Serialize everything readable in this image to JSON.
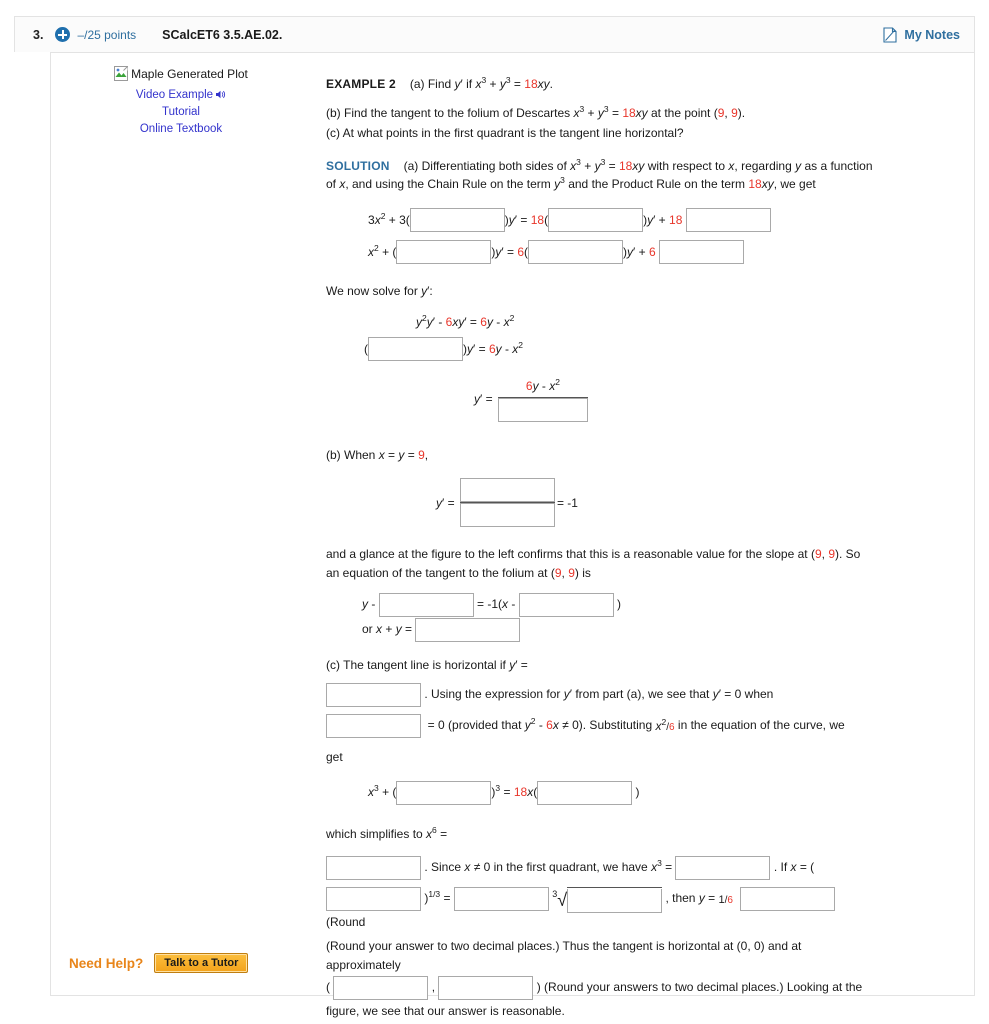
{
  "header": {
    "question_number": "3.",
    "points": "–/25 points",
    "question_key": "SCalcET6 3.5.AE.02.",
    "my_notes_label": "My Notes",
    "plus_icon": "plus-circle-icon",
    "note_icon": "note-page-icon"
  },
  "left_panel": {
    "figure_alt": "Maple Generated Plot",
    "links": [
      {
        "label": "Video Example",
        "icon": "speaker-icon"
      },
      {
        "label": "Tutorial",
        "icon": ""
      },
      {
        "label": "Online Textbook",
        "icon": ""
      }
    ]
  },
  "content": {
    "example_label": "EXAMPLE 2",
    "part_a_prompt_1": "(a) Find ",
    "part_a_prompt_2": "y",
    "part_a_prompt_3": "′ if ",
    "part_a_eq_x3": "x",
    "part_a_plus": " + ",
    "part_a_eq_y3": "y",
    "part_a_equals": " = ",
    "part_a_18": "18",
    "part_a_xy": "xy",
    "part_a_period": ".",
    "part_b_prompt": "(b) Find the tangent to the folium of Descartes ",
    "part_b_at": " at the point (",
    "part_b_pt1": "9",
    "part_b_comma": ", ",
    "part_b_pt2": "9",
    "part_b_close": ").",
    "part_c_prompt": "(c) At what points in the first quadrant is the tangent line horizontal?",
    "solution_label": "SOLUTION",
    "sol_a_1": "(a) Differentiating both sides of ",
    "sol_a_2": " with respect to ",
    "sol_a_3": ", regarding ",
    "sol_a_4": " as a function of ",
    "sol_a_5": ", and using the Chain Rule on the term ",
    "sol_a_6": " and the Product Rule on the term ",
    "sol_a_7": ", we get",
    "eq1": {
      "t1": "3",
      "t1v": "x",
      "t1s": "2",
      "t2": " + 3(",
      "t3": ")",
      "t3v": "y",
      "t3p": "′ = ",
      "t4": "18",
      "t5": "(",
      "t6": ")",
      "t6v": "y",
      "t6p": "′ + ",
      "t7": "18"
    },
    "eq2": {
      "t1v": "x",
      "t1s": "2",
      "t2": " + (",
      "t3": ")",
      "t3v": "y",
      "t3p": "′ = ",
      "t4": "6",
      "t5": "(",
      "t6": ")",
      "t6v": "y",
      "t6p": "′ + ",
      "t7": "6"
    },
    "solve_text_1": "We now solve for ",
    "solve_text_2": "y",
    "solve_text_3": "′:",
    "eq3": {
      "a": "y",
      "a_sup": "2",
      "a2": "y",
      "a3": "′ - ",
      "six": "6",
      "b": "xy",
      "b2": "′ = ",
      "six2": "6",
      "c": "y",
      "c2": " - ",
      "d": "x",
      "d_sup": "2"
    },
    "eq4": {
      "open": "(",
      "close": ")",
      "yp": "y",
      "yp2": "′ = ",
      "six": "6",
      "c": "y",
      "c2": " - ",
      "d": "x",
      "d_sup": "2"
    },
    "eq5": {
      "yp": "y",
      "yp2": "′ = ",
      "num_six": "6",
      "num_y": "y",
      "num_minus": " - ",
      "num_x": "x",
      "num_sup": "2"
    },
    "part_b_when_1": "(b) When ",
    "part_b_when_x": "x",
    "part_b_when_eq": " = ",
    "part_b_when_y": "y",
    "part_b_when_eq2": " = ",
    "part_b_when_9": "9",
    "part_b_when_comma": ",",
    "eq6": {
      "yp": "y",
      "yp2": " = ",
      "result": "= -1"
    },
    "glance_1": "and a glance at the figure to the left confirms that this is a reasonable value for the slope at (",
    "glance_9a": "9",
    "glance_comma": ", ",
    "glance_9b": "9",
    "glance_2": "). So an equation of the tangent to the folium at (",
    "glance_9c": "9",
    "glance_9d": "9",
    "glance_3": ") is",
    "eq7": {
      "y": "y",
      "minus": " - ",
      "eq": " = -1(",
      "x": "x",
      "minus2": " - ",
      "close": ")"
    },
    "eq8": {
      "or": "or ",
      "x": "x",
      "plus": " + ",
      "y": "y",
      "eq": " = "
    },
    "part_c_1": "(c) The tangent line is horizontal if ",
    "part_c_yp": "y",
    "part_c_eq": "′ =",
    "part_c_2": ". Using the expression for ",
    "part_c_yp2": "y",
    "part_c_3": "′ from part (a), we see that ",
    "part_c_yp3": "y",
    "part_c_4": "′ = 0 when",
    "part_c_5": " = 0 (provided that ",
    "part_c_y2": "y",
    "part_c_y2s": "2",
    "part_c_6": " - ",
    "part_c_6x_red": "6",
    "part_c_x": "x",
    "part_c_7": " ≠ 0). Substituting ",
    "part_c_sub_x": "x",
    "part_c_sub_sup": "2",
    "part_c_sub_slash": "/",
    "part_c_sub_6": "6",
    "part_c_8": " in the equation of the curve, we get",
    "eq9": {
      "x": "x",
      "sup": "3",
      "plus": " + (",
      "close": ")",
      "close_sup": "3",
      "eq": " = ",
      "eighteen": "18",
      "xopen": "x(",
      "rclose": ")"
    },
    "simplifies_1": "which simplifies to ",
    "simplifies_x": "x",
    "simplifies_sup": "6",
    "simplifies_eq": " =",
    "since_1": ". Since ",
    "since_x": "x",
    "since_2": " ≠ 0 in the first quadrant, we have ",
    "since_x3": "x",
    "since_x3_sup": "3",
    "since_eq": " = ",
    "since_3": ". If ",
    "since_x2": "x",
    "since_4": " = (",
    "cube_close": ")",
    "cube_exp": "1/3",
    "cube_eq": " = ",
    "cbrt_index": "3",
    "cbrt_radical": "√",
    "then_1": ", then ",
    "then_y": "y",
    "then_eq": " = ",
    "then_frac_n": "1",
    "then_frac_slash": "/",
    "then_frac_d": "6",
    "round_1": "(Round your answer to two decimal places.) Thus the tangent is horizontal at (0, 0) and at approximately",
    "approx_open": "(",
    "approx_comma": ",",
    "approx_close": ")",
    "round_2": " (Round your answers to two decimal places.) Looking at the figure, we see that our answer is reasonable.",
    "input_placeholder": ""
  },
  "footer": {
    "need_help_label": "Need Help?",
    "tutor_button_label": "Talk to a Tutor"
  },
  "colors": {
    "red": "#e8352a",
    "link_blue": "#3333cc",
    "header_blue": "#2f6f9f",
    "orange": "#e8851a"
  }
}
